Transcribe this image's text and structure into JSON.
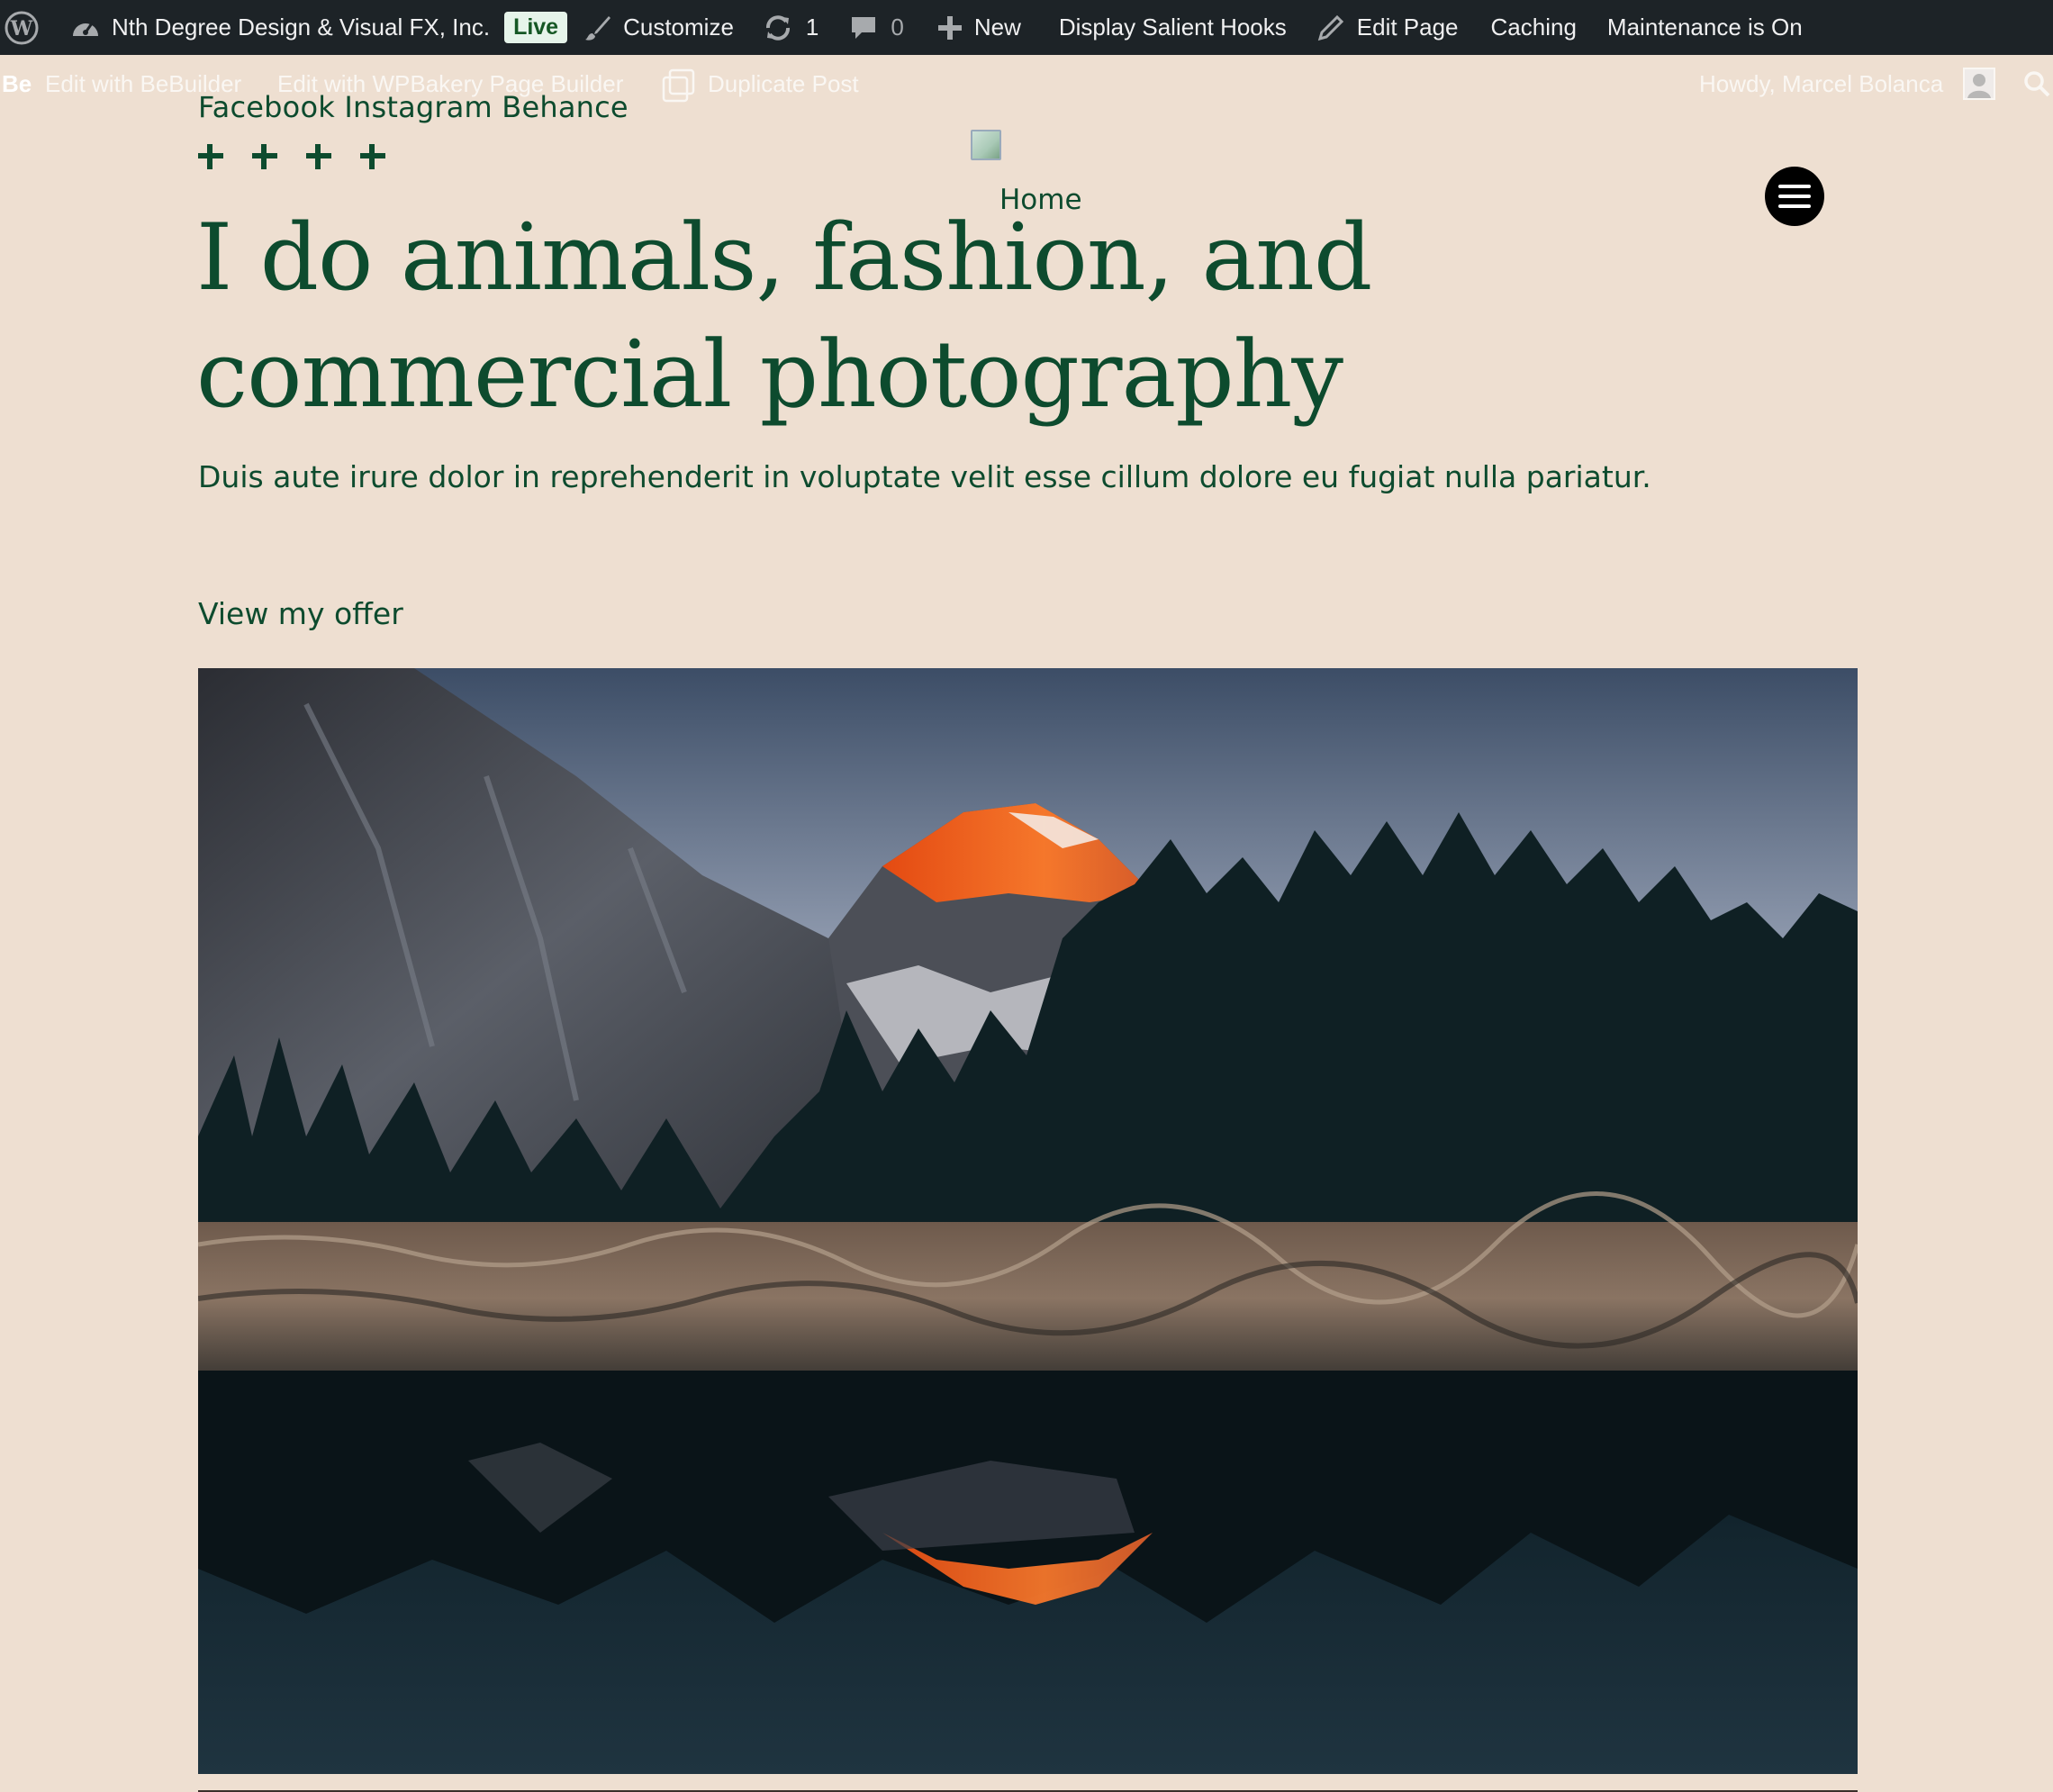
{
  "adminbar": {
    "site_name": "Nth Degree Design & Visual FX, Inc.",
    "live_badge": "Live",
    "customize": "Customize",
    "updates_count": "1",
    "comments_count": "0",
    "new_label": "New",
    "salient_hooks": "Display Salient Hooks",
    "edit_page": "Edit Page",
    "caching": "Caching",
    "maintenance": "Maintenance is On"
  },
  "subbar": {
    "be_logo": "Be",
    "edit_bebuilder": "Edit with BeBuilder",
    "edit_wpbakery": "Edit with WPBakery Page Builder",
    "duplicate_post": "Duplicate Post",
    "howdy": "Howdy, Marcel Bolanca"
  },
  "header": {
    "social_links": "Facebook Instagram Behance",
    "nav_home": "Home"
  },
  "hero": {
    "title": "I do animals, fashion, and commercial photography",
    "subtitle": "Duis aute irure dolor in reprehenderit in voluptate velit esse cillum dolore eu fugiat nulla pariatur.",
    "cta": "View my offer"
  },
  "colors": {
    "background": "#eedfd1",
    "brand_green": "#0d4b2e",
    "adminbar": "#1d2327"
  }
}
